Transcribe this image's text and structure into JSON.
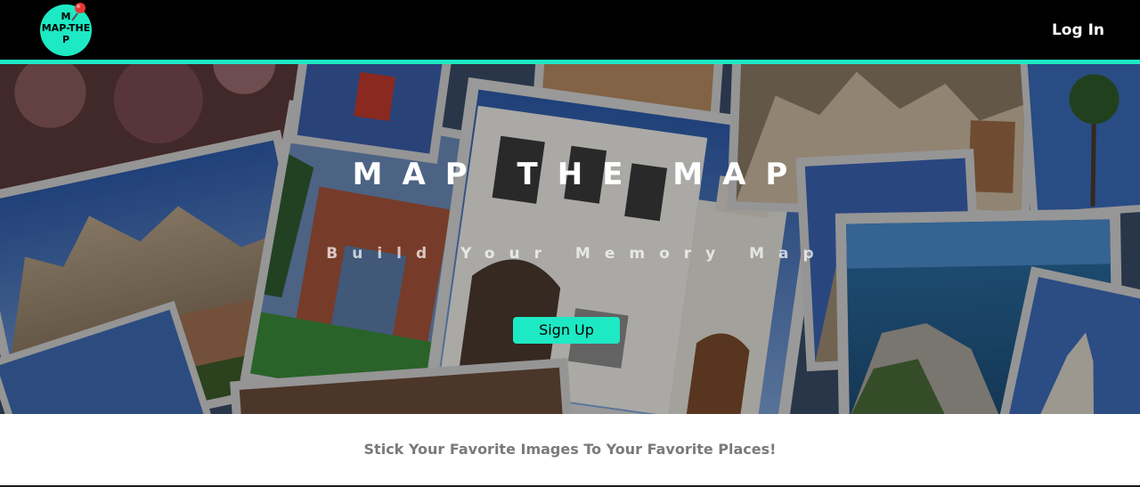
{
  "header": {
    "logo_text": "M\nMAP-THE\nP",
    "login_label": "Log In"
  },
  "hero": {
    "title": "MAP THE MAP",
    "subtitle": "Build Your Memory Map",
    "signup_label": "Sign Up"
  },
  "tagline": "Stick Your Favorite Images To Your Favorite Places!",
  "colors": {
    "accent": "#1de9c4",
    "nav_bg": "#000000",
    "tagline": "#7a7a7a"
  },
  "icons": {
    "logo_pin": "map-pin-icon"
  }
}
